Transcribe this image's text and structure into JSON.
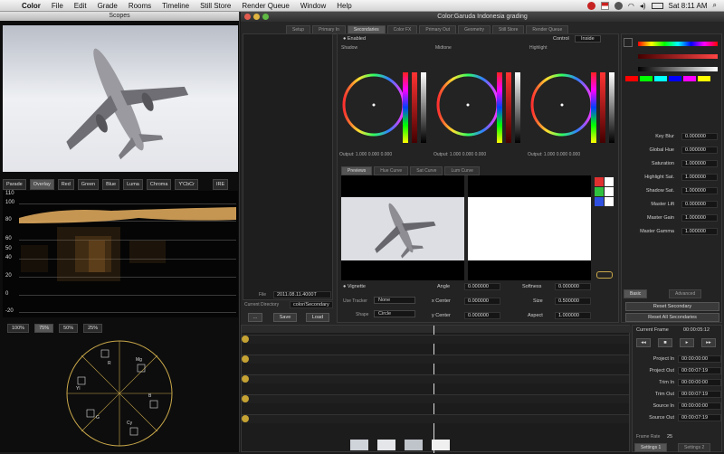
{
  "menubar": {
    "items": [
      "Color",
      "File",
      "Edit",
      "Grade",
      "Rooms",
      "Timeline",
      "Still Store",
      "Render Queue",
      "Window",
      "Help"
    ],
    "clock": "Sat 8:11 AM"
  },
  "scopes": {
    "title": "Scopes",
    "tabs": [
      "Parade",
      "Overlay",
      "Red",
      "Green",
      "Blue",
      "Luma",
      "Chroma",
      "Y'CbCr",
      "IRE"
    ],
    "active_tab": "Overlay",
    "waveform_scale": [
      "110",
      "100",
      "80",
      "60",
      "50",
      "40",
      "20",
      "0",
      "-20"
    ],
    "zoom_tabs": [
      "100%",
      "75%",
      "50%",
      "25%"
    ],
    "active_zoom": "75%",
    "vectorscope_labels": [
      "R",
      "Mg",
      "B",
      "Cy",
      "G",
      "Yl"
    ]
  },
  "color_window": {
    "title": "Color:Garuda Indonesia grading",
    "room_tabs": [
      "Setup",
      "Primary In",
      "Secondaries",
      "Color FX",
      "Primary Out",
      "Geometry",
      "Still Store",
      "Render Queue"
    ],
    "active_room": "Secondaries",
    "enabled_label": "Enabled",
    "control_label": "Control",
    "control_value": "Inside",
    "wheels": [
      {
        "name": "Shadow",
        "readout": "Output: 1.000 0.000 0.000"
      },
      {
        "name": "Midtone",
        "readout": "Output: 1.000 0.000 0.000"
      },
      {
        "name": "Highlight",
        "readout": "Output: 1.000 0.000 0.000"
      }
    ],
    "preview_tabs": [
      "Previews",
      "Hue Curve",
      "Sat Curve",
      "Lum Curve"
    ],
    "vignette_label": "Vignette",
    "use_tracker_label": "Use Tracker",
    "use_tracker_value": "None",
    "shape_label": "Shape",
    "shape_value": "Circle",
    "vignette_params": [
      {
        "label": "Angle",
        "value": "0.000000"
      },
      {
        "label": "Softness",
        "value": "0.000000"
      },
      {
        "label": "x Center",
        "value": "0.000000"
      },
      {
        "label": "Size",
        "value": "0.500000"
      },
      {
        "label": "y Center",
        "value": "0.000000"
      },
      {
        "label": "Aspect",
        "value": "1.000000"
      }
    ],
    "file_label": "File",
    "file_value": "2011.08.11.4000T",
    "current_dir_label": "Current Directory",
    "current_dir_value": "color/Secondary",
    "dir_buttons": [
      "Save",
      "Load"
    ],
    "params": [
      {
        "label": "Key Blur",
        "value": "0.000000"
      },
      {
        "label": "Global Hue",
        "value": "0.000000"
      },
      {
        "label": "Saturation",
        "value": "1.000000"
      },
      {
        "label": "Highlight Sat.",
        "value": "1.000000"
      },
      {
        "label": "Shadow Sat.",
        "value": "1.000000"
      },
      {
        "label": "Master Lift",
        "value": "0.000000"
      },
      {
        "label": "Master Gain",
        "value": "1.000000"
      },
      {
        "label": "Master Gamma",
        "value": "1.000000"
      }
    ],
    "basic_tab": "Basic",
    "advanced_tab": "Advanced",
    "reset_secondary": "Reset Secondary",
    "reset_all": "Reset All Secondaries",
    "current_frame_label": "Current Frame",
    "current_frame_value": "00:00:05:12",
    "timecode_rows": [
      {
        "label": "Project In",
        "value": "00:00:00:00"
      },
      {
        "label": "Project Out",
        "value": "00:00:07:19"
      },
      {
        "label": "Trim In",
        "value": "00:00:00:00"
      },
      {
        "label": "Trim Out",
        "value": "00:00:07:19"
      },
      {
        "label": "Source In",
        "value": "00:00:00:00"
      },
      {
        "label": "Source Out",
        "value": "00:00:07:19"
      }
    ],
    "frame_rate_label": "Frame Rate",
    "frame_rate_value": "25",
    "settings_tabs": [
      "Settings 1",
      "Settings 2"
    ]
  }
}
